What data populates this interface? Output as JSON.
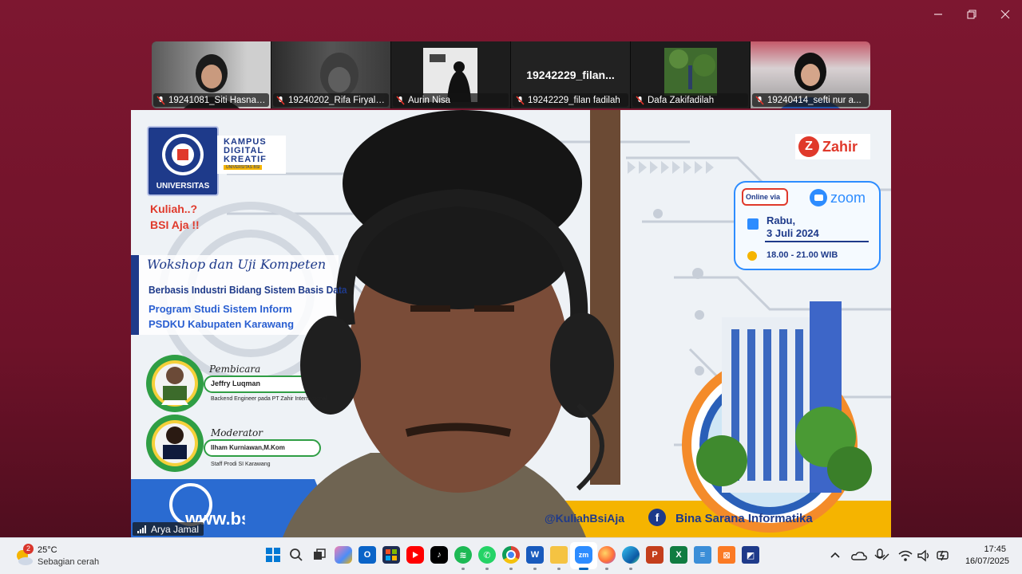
{
  "participants": [
    {
      "name": "19241081_Siti Hasna ..."
    },
    {
      "name": "19240202_Rifa Firyal ..."
    },
    {
      "name": "Aurin Nisa"
    },
    {
      "name": "19242229_filan fadilah",
      "display_name": "19242229_filan..."
    },
    {
      "name": "Dafa Zakifadilah"
    },
    {
      "name": "19240414_sefti nur a..."
    }
  ],
  "main_speaker": {
    "name": "Arya Jamal"
  },
  "slide": {
    "univ_logo": "UNIVERSITAS",
    "kampus_line1": "KAMPUS",
    "kampus_line2": "DIGITAL",
    "kampus_line3": "KREATIF",
    "kampus_sub": "UNIVERSITAS BSI",
    "tagline1": "Kuliah..?",
    "tagline2": "BSI Aja !!",
    "sponsor": "Zahir",
    "workshop_script": "Wokshop dan Uji Kompeten",
    "workshop_line2": "Berbasis Industri Bidang Sistem Basis Data",
    "workshop_line3": "Program Studi Sistem Inform",
    "workshop_line4": "PSDKU Kabupaten Karawang",
    "online_via": "Online via",
    "zoom": "zoom",
    "day": "Rabu,",
    "date": "3 Juli 2024",
    "time": "18.00 - 21.00 WIB",
    "speaker_role": "Pembicara",
    "speaker_name": "Jeffry Luqman",
    "speaker_desc": "Backend Engineer pada PT Zahir Internasional",
    "moderator_role": "Moderator",
    "moderator_name": "Ilham Kurniawan,M.Kom",
    "moderator_desc": "Staff Prodi SI Karawang",
    "website": "www.bsi.ac.id",
    "instagram": "@KuliahBsiAja",
    "facebook": "Bina Sarana Informatika"
  },
  "taskbar": {
    "weather_temp": "25°C",
    "weather_desc": "Sebagian cerah",
    "weather_badge": "2",
    "time": "17:45",
    "date": "16/07/2025",
    "apps": [
      "windows-start",
      "search",
      "task-view",
      "copilot",
      "outlook",
      "store",
      "youtube",
      "tiktok",
      "spotify",
      "whatsapp",
      "chrome",
      "word",
      "file-explorer",
      "zoom",
      "firefox",
      "edge",
      "powerpoint",
      "excel",
      "notepad",
      "xampp",
      "app"
    ]
  },
  "colors": {
    "window_bg": "#7d1730",
    "bsi_blue": "#1e3a8a",
    "accent_yellow": "#f5b400",
    "zoom_blue": "#2d8cff",
    "zahir_red": "#e0392b"
  }
}
